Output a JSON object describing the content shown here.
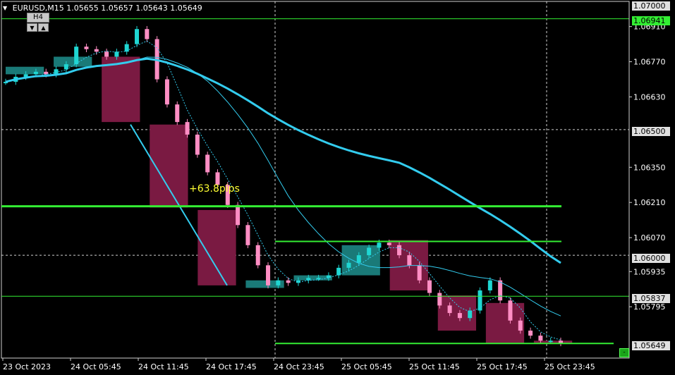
{
  "symbol_info": {
    "symbol": "EURUSD,M15",
    "open": "1.05655",
    "high": "1.05657",
    "low": "1.05643",
    "close": "1.05649"
  },
  "timeframe": {
    "label": "H4",
    "down_glyph": "▼",
    "up_glyph": "▲"
  },
  "annotation": "+63.8pips",
  "price_scale": [
    "1.06910",
    "1.06770",
    "1.06630",
    "1.06350",
    "1.06210",
    "1.06070",
    "1.05935",
    "1.05795"
  ],
  "price_tags": {
    "top": "1.07000",
    "green_level": "1.06941",
    "level_1": "1.06500",
    "level_2": "1.06000",
    "level_3": "1.05837",
    "current": "1.05649"
  },
  "time_scale": [
    "23 Oct 2023",
    "24 Oct 05:45",
    "24 Oct 11:45",
    "24 Oct 17:45",
    "24 Oct 23:45",
    "25 Oct 05:45",
    "25 Oct 11:45",
    "25 Oct 17:45",
    "25 Oct 23:45"
  ],
  "scroll_button": "-",
  "colors": {
    "background": "#000000",
    "bull_box": "#1a7a78",
    "bear_box": "#7a1a42",
    "bull_candle": "#1fd6d2",
    "bear_candle": "#ff8ec4",
    "ma": "#33ccee",
    "level_line": "#33ee33",
    "pips_text": "#ffff33"
  },
  "chart_data": {
    "type": "candlestick",
    "symbol": "EURUSD",
    "timeframe": "M15",
    "x_ticks": [
      "23 Oct 2023",
      "24 Oct 05:45",
      "24 Oct 11:45",
      "24 Oct 17:45",
      "24 Oct 23:45",
      "25 Oct 05:45",
      "25 Oct 11:45",
      "25 Oct 17:45",
      "25 Oct 23:45"
    ],
    "ylim": [
      1.0563,
      1.0701
    ],
    "horizontal_levels": [
      1.06941,
      1.065,
      1.06195,
      1.06055,
      1.06,
      1.05837,
      1.05649
    ],
    "h4_boxes": [
      {
        "open": 1.0672,
        "close": 1.0675,
        "dir": "up"
      },
      {
        "open": 1.0675,
        "close": 1.0679,
        "dir": "up"
      },
      {
        "open": 1.0679,
        "close": 1.0653,
        "dir": "down"
      },
      {
        "open": 1.0652,
        "close": 1.0619,
        "dir": "down"
      },
      {
        "open": 1.0618,
        "close": 1.0588,
        "dir": "down"
      },
      {
        "open": 1.0587,
        "close": 1.059,
        "dir": "up"
      },
      {
        "open": 1.059,
        "close": 1.0592,
        "dir": "up"
      },
      {
        "open": 1.0592,
        "close": 1.0604,
        "dir": "up"
      },
      {
        "open": 1.0606,
        "close": 1.0586,
        "dir": "down"
      },
      {
        "open": 1.0584,
        "close": 1.057,
        "dir": "down"
      },
      {
        "open": 1.0581,
        "close": 1.0565,
        "dir": "down"
      },
      {
        "open": 1.0566,
        "close": 1.0565,
        "dir": "down"
      }
    ],
    "close_path": [
      1.0669,
      1.0671,
      1.0672,
      1.0673,
      1.0672,
      1.0674,
      1.0676,
      1.0683,
      1.0682,
      1.0681,
      1.0679,
      1.0681,
      1.0684,
      1.069,
      1.0686,
      1.067,
      1.066,
      1.0653,
      1.0648,
      1.064,
      1.0633,
      1.0628,
      1.062,
      1.0612,
      1.0604,
      1.0596,
      1.0588,
      1.059,
      1.0589,
      1.059,
      1.0591,
      1.0591,
      1.0592,
      1.0595,
      1.0597,
      1.06,
      1.0603,
      1.0605,
      1.0604,
      1.06,
      1.0596,
      1.059,
      1.0585,
      1.058,
      1.0577,
      1.0575,
      1.0578,
      1.0586,
      1.059,
      1.0582,
      1.0574,
      1.057,
      1.0568,
      1.0566,
      1.0566,
      1.0565
    ]
  }
}
